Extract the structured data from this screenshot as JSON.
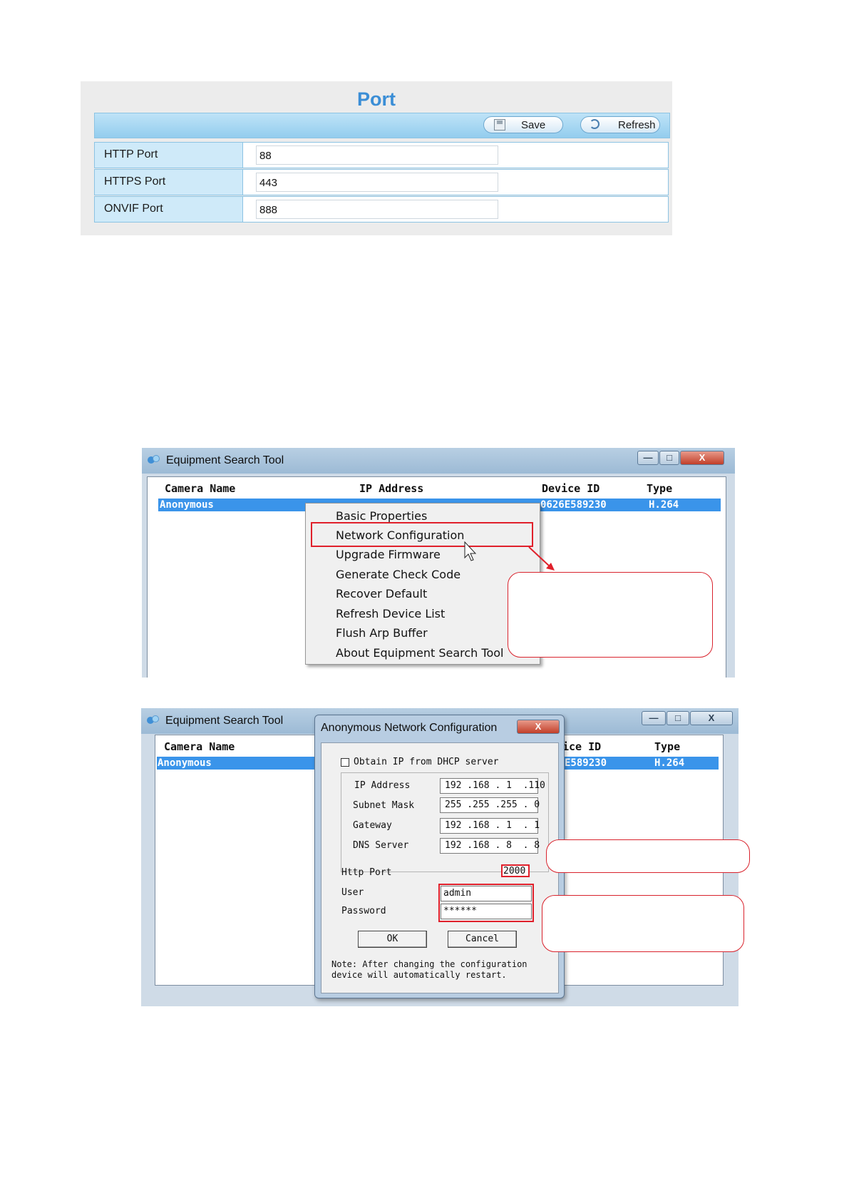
{
  "port_panel": {
    "title": "Port",
    "save_label": "Save",
    "refresh_label": "Refresh",
    "rows": [
      {
        "label": "HTTP Port",
        "value": "88"
      },
      {
        "label": "HTTPS Port",
        "value": "443"
      },
      {
        "label": "ONVIF Port",
        "value": "888"
      }
    ]
  },
  "search_tool_1": {
    "title": "Equipment Search Tool",
    "min": "—",
    "max": "□",
    "close": "X",
    "columns": {
      "camera_name": "Camera Name",
      "ip_address": "IP Address",
      "device_id": "Device ID",
      "type": "Type"
    },
    "row": {
      "camera_name": "Anonymous",
      "device_id": "0626E589230",
      "type": "H.264"
    },
    "menu": [
      "Basic Properties",
      "Network Configuration",
      "Upgrade Firmware",
      "Generate Check Code",
      "Recover Default",
      "Refresh Device List",
      "Flush Arp Buffer",
      "About Equipment Search Tool"
    ]
  },
  "search_tool_2": {
    "title": "Equipment Search Tool",
    "min": "—",
    "max": "□",
    "close": "X",
    "columns": {
      "camera_name": "Camera Name",
      "device_id": "ice ID",
      "type": "Type"
    },
    "row": {
      "camera_name": "Anonymous",
      "device_id": "E589230",
      "type": "H.264"
    }
  },
  "network_dialog": {
    "title": "Anonymous Network Configuration",
    "close": "X",
    "dhcp_label": "Obtain IP from DHCP server",
    "fields": [
      {
        "label": "IP Address",
        "value": "192 .168 . 1  .110"
      },
      {
        "label": "Subnet Mask",
        "value": "255 .255 .255 . 0"
      },
      {
        "label": "Gateway",
        "value": "192 .168 . 1  . 1"
      },
      {
        "label": "DNS Server",
        "value": "192 .168 . 8  . 8"
      }
    ],
    "http_port_label": "Http Port",
    "http_port_value": "2000",
    "user_label": "User",
    "user_value": "admin",
    "password_label": "Password",
    "password_value": "******",
    "ok_label": "OK",
    "cancel_label": "Cancel",
    "note_line1": "Note: After changing the configuration",
    "note_line2": "device will automatically restart."
  },
  "colors": {
    "accent": "#3b8ed6",
    "highlight": "#e0202b",
    "selection": "#3a94ea"
  }
}
